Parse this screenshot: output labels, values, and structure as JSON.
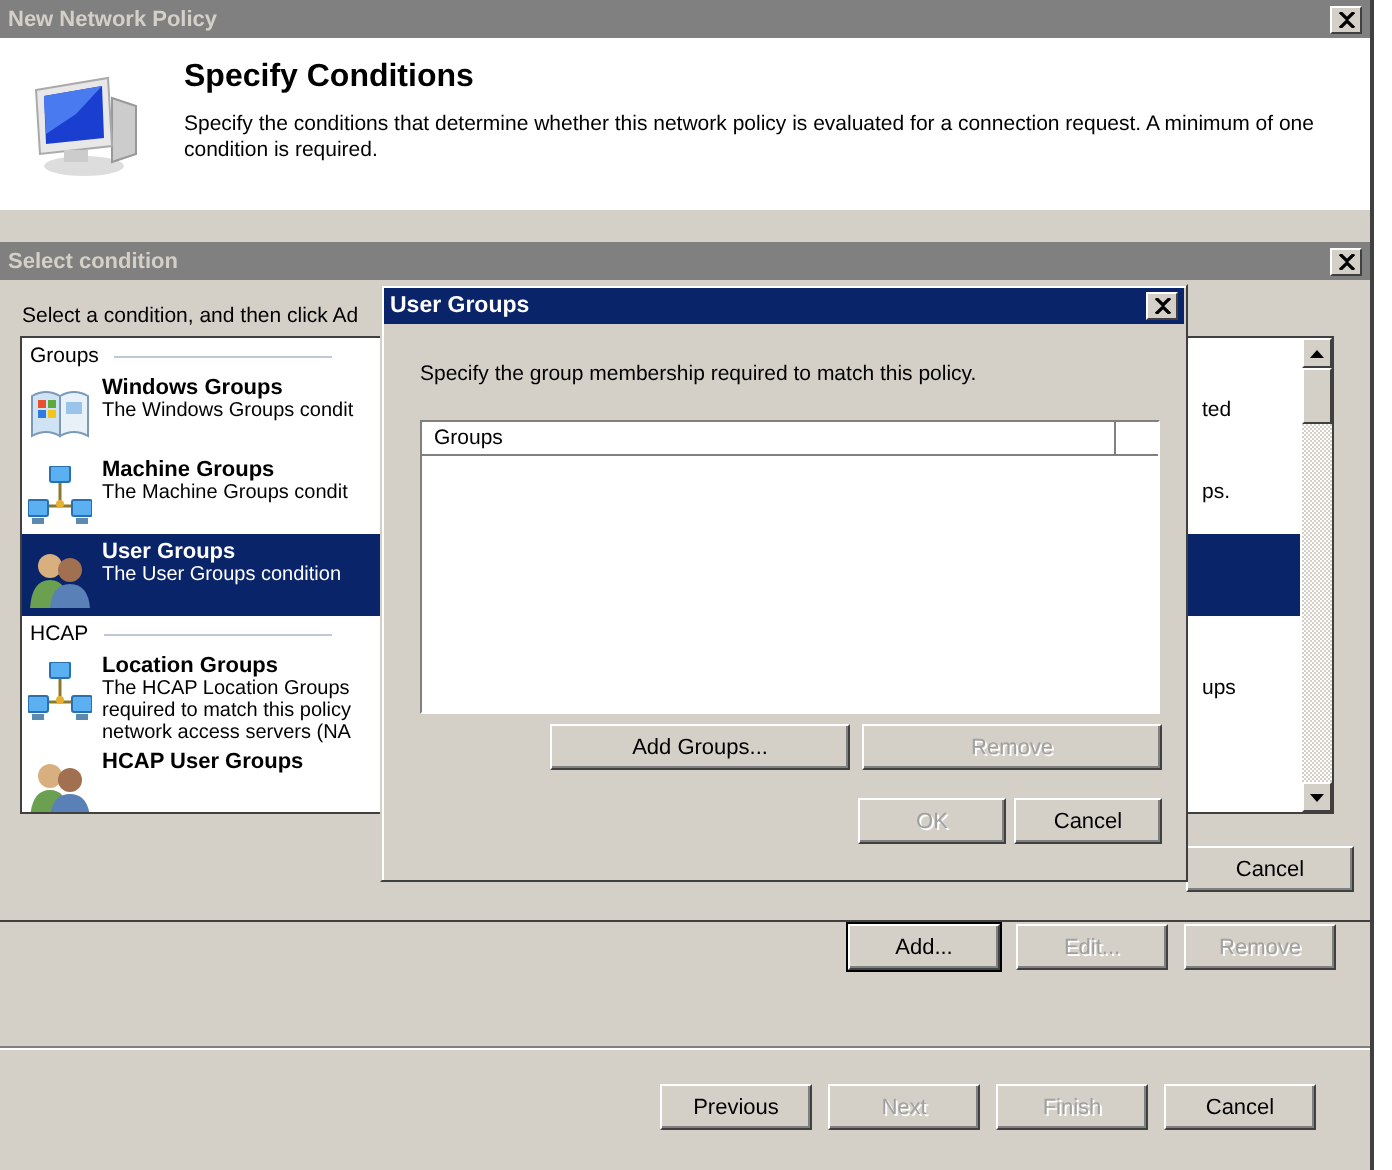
{
  "window": {
    "title": "New Network Policy"
  },
  "header": {
    "title": "Specify Conditions",
    "description": "Specify the conditions that determine whether this network policy is evaluated for a connection request. A minimum of one condition is required."
  },
  "select_condition": {
    "title": "Select condition",
    "instruction": "Select a condition, and then click Ad",
    "sections": [
      {
        "label": "Groups",
        "items": [
          {
            "kind": "windows",
            "name": "Windows Groups",
            "lines": [
              "The Windows Groups condit"
            ],
            "right_lines": [
              "ted"
            ],
            "selected": false
          },
          {
            "kind": "network",
            "name": "Machine Groups",
            "lines": [
              "The Machine Groups condit"
            ],
            "right_lines": [
              "ps."
            ],
            "selected": false
          },
          {
            "kind": "users",
            "name": "User Groups",
            "lines": [
              "The User Groups condition"
            ],
            "selected": true
          }
        ]
      },
      {
        "label": "HCAP",
        "items": [
          {
            "kind": "network",
            "name": "Location Groups",
            "lines": [
              "The HCAP Location Groups",
              "required to match this policy",
              "network access servers (NA"
            ],
            "right_lines": [
              "ups"
            ],
            "selected": false
          },
          {
            "kind": "users",
            "name": "HCAP User Groups",
            "selected": false
          }
        ]
      }
    ],
    "buttons": [
      {
        "label": "Cancel",
        "disabled": false
      }
    ]
  },
  "user_groups": {
    "title": "User Groups",
    "instruction": "Specify the group membership required to match this policy.",
    "columns": [
      "Groups"
    ],
    "list_buttons": [
      {
        "label": "Add Groups...",
        "disabled": false
      },
      {
        "label": "Remove",
        "disabled": true
      }
    ],
    "buttons": [
      {
        "label": "OK",
        "disabled": true
      },
      {
        "label": "Cancel",
        "disabled": false
      }
    ]
  },
  "condition_buttons": [
    {
      "label": "Add...",
      "disabled": false
    },
    {
      "label": "Edit...",
      "disabled": true
    },
    {
      "label": "Remove",
      "disabled": true
    }
  ],
  "nav_buttons": [
    {
      "label": "Previous",
      "disabled": false
    },
    {
      "label": "Next",
      "disabled": true
    },
    {
      "label": "Finish",
      "disabled": true
    },
    {
      "label": "Cancel",
      "disabled": false
    }
  ]
}
